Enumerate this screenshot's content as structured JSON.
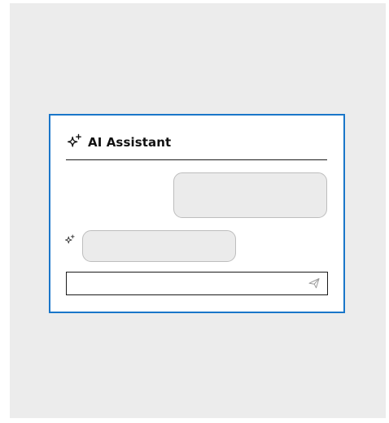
{
  "widget": {
    "title": "AI Assistant",
    "accent_color": "#1a76c9",
    "header_icon": "sparkle-icon"
  },
  "conversation": {
    "messages": [
      {
        "role": "user",
        "text": ""
      },
      {
        "role": "assistant",
        "text": "",
        "icon": "sparkle-icon"
      }
    ]
  },
  "composer": {
    "value": "",
    "placeholder": "",
    "send_icon": "send-icon"
  }
}
